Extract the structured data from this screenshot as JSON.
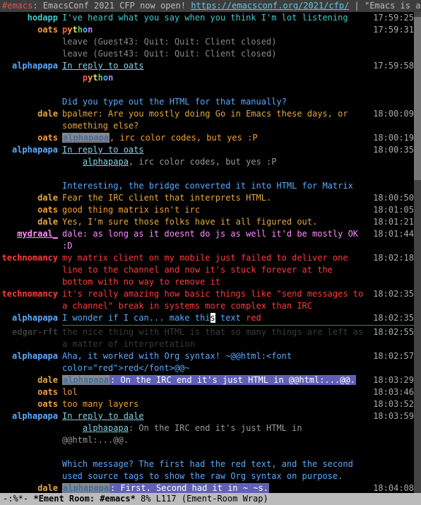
{
  "header": {
    "channel_prefix": "#emacs",
    "topic": ": EmacsConf 2021 CFP now open! ",
    "url": "https://emacsconf.org/2021/cfp/",
    "tail": " | \"Emacs is a co"
  },
  "nicks": {
    "hodapp": "hodapp",
    "oats": "oats",
    "alphapapa": "alphapapa",
    "dale": "dale",
    "mydraal": "mydraal_",
    "technomancy": "technomancy",
    "edgar": "edgar-rft"
  },
  "msgs": {
    "m01": "I've heard what you say when you think I'm lot listening",
    "leave": "leave (Guest43: Quit: Quit: Client closed)",
    "reply_to": "In reply to ",
    "m04": "Did you type out the HTML for that manually?",
    "m05": "bpalmer: Are you mostly doing Go in Emacs these days, or something else?",
    "m06": ", irc color codes, but yes :P",
    "m07": ", irc color codes, but yes :P",
    "m08": "Interesting, the bridge converted it into HTML for Matrix",
    "m09": "Fear the IRC client that interprets HTML.",
    "m10": "good thing matrix isn't irc",
    "m11": "Yes, I'm sure those folks have it all figured out.",
    "m12": "dale: as long as it doesnt do js as well it'd be mostly OK :D",
    "m13": "my matrix client on my mobile just failed to deliver one line to the channel and now it's stuck forever at the bottom with no way to remove it",
    "m14": "it's really amazing how basic things like \"send messages to a channel\" break in systems more complex than IRC",
    "m15a": "I wonder if I can... make thi",
    "m15b": "s",
    "m15c": " text ",
    "m15d": "red",
    "m16": "the nice thing with HTML is that so many things are left as a matter of interpretation",
    "m17": "Aha, it worked with Org syntax!  ~@@html:<font color=\"red\">red</font>@@~",
    "m18": ": On the IRC end it's just HTML in @@html:...@@.",
    "m19": "lol",
    "m20": "too many layers",
    "m21": ": On the IRC end it's just HTML in @@html:...@@.",
    "m22": "Which message? The first had the red text, and the second used source tags to show the raw Org syntax on purpose.",
    "m23": ": First. Second had it in ~ ~s."
  },
  "times": {
    "t01": "17:59:25",
    "t02": "17:59:31",
    "t03": "17:59:58",
    "t05": "18:00:09",
    "t06": "18:00:19",
    "t07": "18:00:35",
    "t09": "18:00:50",
    "t10": "18:01:05",
    "t11": "18:01:21",
    "t12": "18:01:44",
    "t13": "18:02:18",
    "t14": "18:02:35",
    "t15": "18:02:35",
    "t16": "18:02:55",
    "t17": "18:02:57",
    "t18": "18:03:29",
    "t19": "18:03:46",
    "t20": "18:03:52",
    "t21": "18:03:59",
    "t23": "18:04:08"
  },
  "modeline": {
    "left": "-:%*-  ",
    "buffer": "*Ement Room: #emacs*",
    "mid": "   8% L117   (Ement-Room Wrap)"
  },
  "scrollbar": {
    "top_pct": 1,
    "height_pct": 34
  }
}
